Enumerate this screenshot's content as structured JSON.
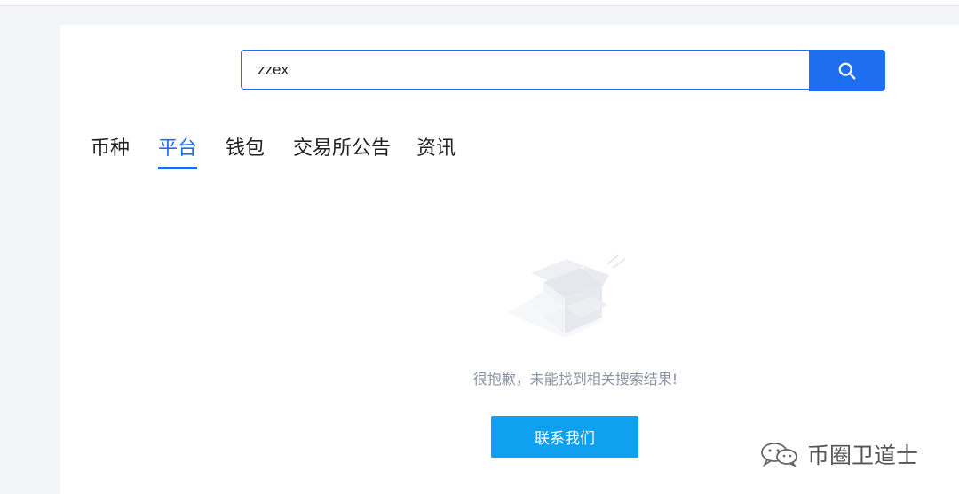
{
  "search": {
    "value": "zzex",
    "button_icon": "search-icon"
  },
  "tabs": [
    {
      "label": "币种",
      "active": false
    },
    {
      "label": "平台",
      "active": true
    },
    {
      "label": "钱包",
      "active": false
    },
    {
      "label": "交易所公告",
      "active": false
    },
    {
      "label": "资讯",
      "active": false
    }
  ],
  "empty_state": {
    "icon": "empty-box-icon",
    "message": "很抱歉，未能找到相关搜索结果!"
  },
  "contact_button": {
    "label": "联系我们"
  },
  "watermark": {
    "icon": "wechat-icon",
    "text": "币圈卫道士"
  },
  "colors": {
    "primary": "#1e6ff0",
    "contact": "#10a0f0",
    "muted_text": "#8a93a3"
  }
}
